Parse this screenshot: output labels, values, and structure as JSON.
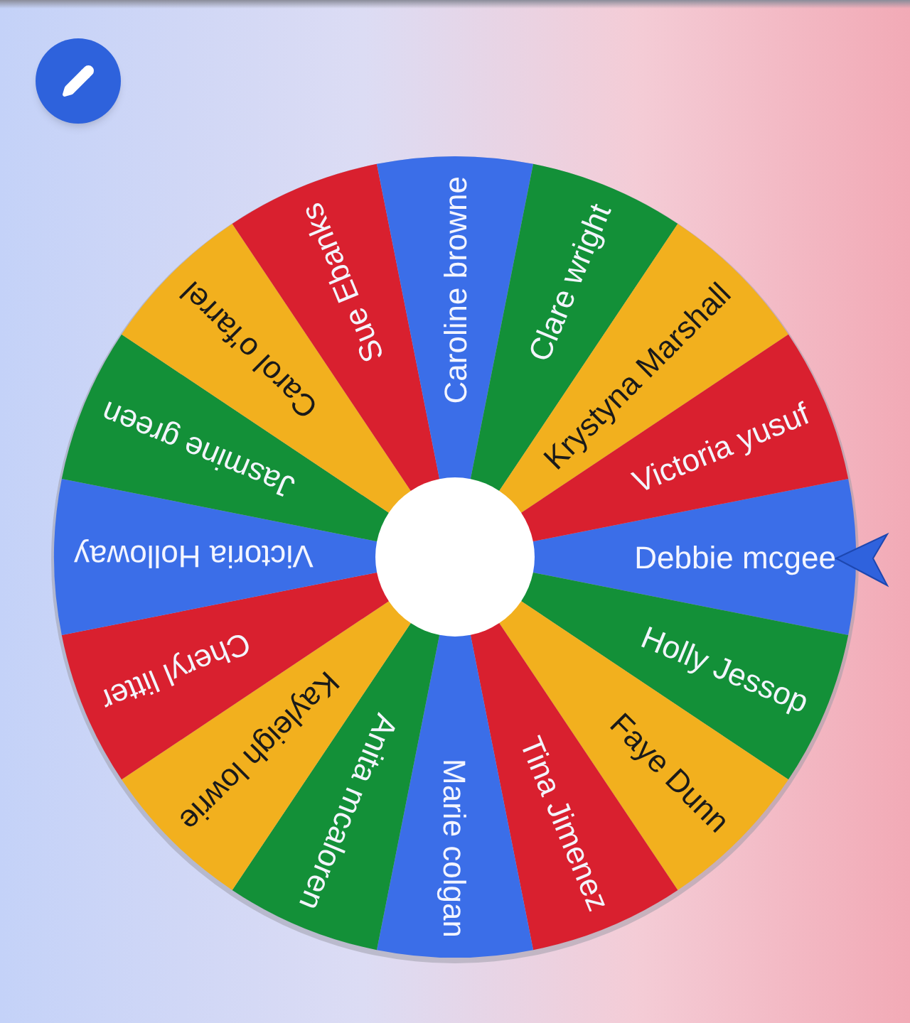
{
  "wheel": {
    "segments": [
      {
        "name": "Debbie mcgee",
        "color": "#3b6ee8"
      },
      {
        "name": "Holly Jessop",
        "color": "#139038"
      },
      {
        "name": "Faye Dunn",
        "color": "#f2b01e"
      },
      {
        "name": "Tina Jimenez",
        "color": "#d9202f"
      },
      {
        "name": "Marie colgan",
        "color": "#3b6ee8"
      },
      {
        "name": "Anita mcaloren",
        "color": "#139038"
      },
      {
        "name": "Kayleigh lowrie",
        "color": "#f2b01e"
      },
      {
        "name": "Cheryl litter",
        "color": "#d9202f"
      },
      {
        "name": "Victoria Holloway",
        "color": "#3b6ee8"
      },
      {
        "name": "Jasmine green",
        "color": "#139038"
      },
      {
        "name": "Carol o'farrel",
        "color": "#f2b01e"
      },
      {
        "name": "Sue Ebanks",
        "color": "#d9202f"
      },
      {
        "name": "Caroline browne",
        "color": "#3b6ee8"
      },
      {
        "name": "Clare wright",
        "color": "#139038"
      },
      {
        "name": "Krystyna Marshall",
        "color": "#f2b01e"
      },
      {
        "name": "Victoria yusuf",
        "color": "#d9202f"
      }
    ]
  }
}
